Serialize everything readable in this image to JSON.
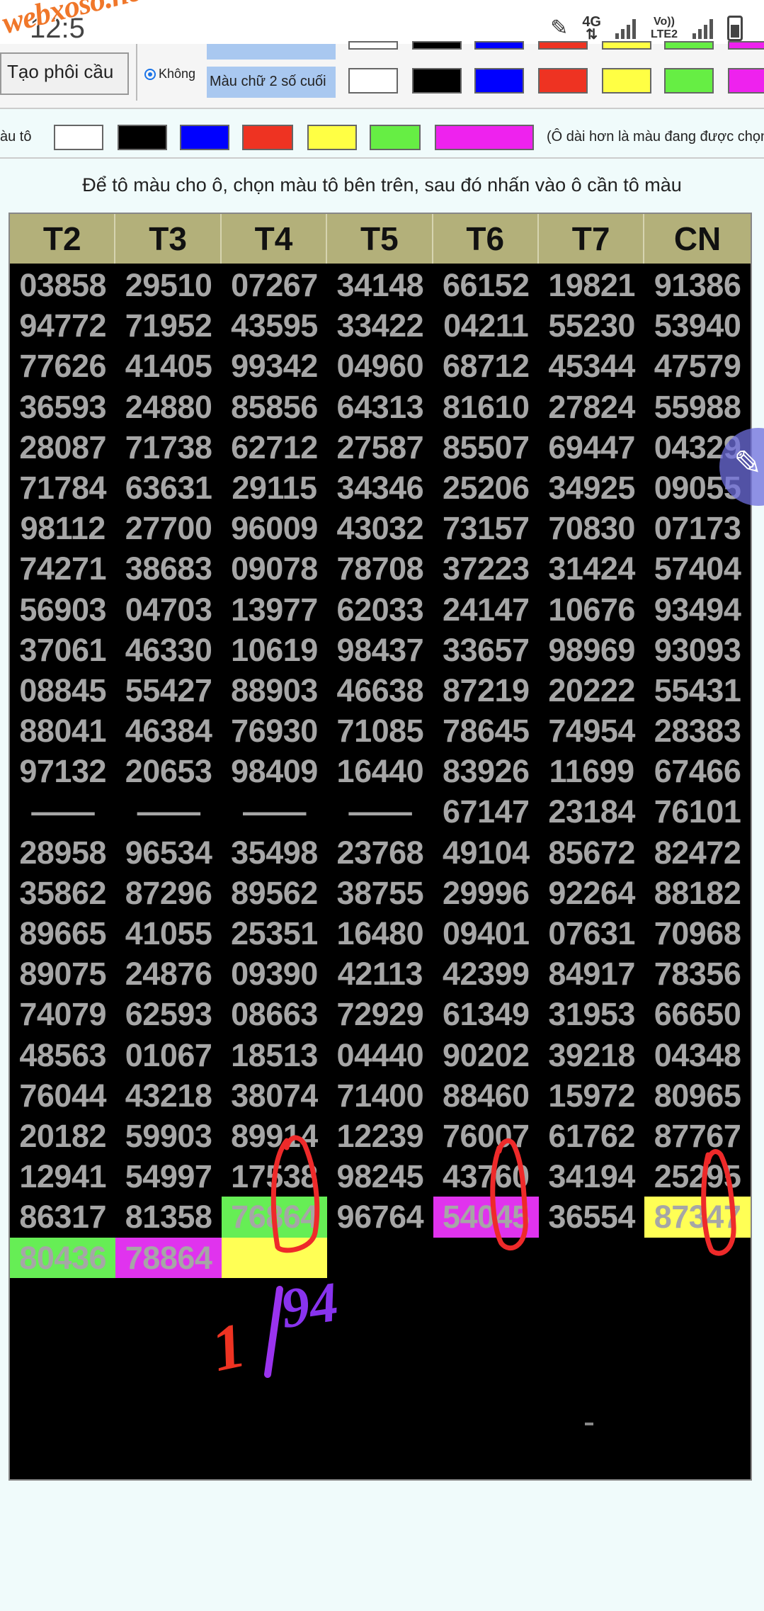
{
  "status_bar": {
    "time": "12:5",
    "logo_text": "webxoso.net",
    "network": "4G",
    "volte": "Vo)) LTE2"
  },
  "toolbar": {
    "create_button": "Tạo phôi cầu",
    "radio_label": "Không",
    "text_color_label": "Màu chữ 2 số cuối",
    "swatches": [
      "#ffffff",
      "#000000",
      "#0000ff",
      "#ee3322",
      "#ffff44",
      "#66ee44",
      "#ee22ee"
    ]
  },
  "fill_row": {
    "label": "àu tô",
    "swatches": [
      "#ffffff",
      "#000000",
      "#0000ff",
      "#ee3322",
      "#ffff44",
      "#66ee44",
      "#ee22ee"
    ],
    "note": "(Ô dài hơn là màu đang được chọn"
  },
  "instruction": "Để tô màu cho ô, chọn màu tô bên trên, sau đó nhấn vào ô cần tô màu",
  "table": {
    "headers": [
      "T2",
      "T3",
      "T4",
      "T5",
      "T6",
      "T7",
      "CN"
    ],
    "rows": [
      [
        "03858",
        "29510",
        "07267",
        "34148",
        "66152",
        "19821",
        "91386"
      ],
      [
        "94772",
        "71952",
        "43595",
        "33422",
        "04211",
        "55230",
        "53940"
      ],
      [
        "77626",
        "41405",
        "99342",
        "04960",
        "68712",
        "45344",
        "47579"
      ],
      [
        "36593",
        "24880",
        "85856",
        "64313",
        "81610",
        "27824",
        "55988"
      ],
      [
        "28087",
        "71738",
        "62712",
        "27587",
        "85507",
        "69447",
        "04329"
      ],
      [
        "71784",
        "63631",
        "29115",
        "34346",
        "25206",
        "34925",
        "09055"
      ],
      [
        "98112",
        "27700",
        "96009",
        "43032",
        "73157",
        "70830",
        "07173"
      ],
      [
        "74271",
        "38683",
        "09078",
        "78708",
        "37223",
        "31424",
        "57404"
      ],
      [
        "56903",
        "04703",
        "13977",
        "62033",
        "24147",
        "10676",
        "93494"
      ],
      [
        "37061",
        "46330",
        "10619",
        "98437",
        "33657",
        "98969",
        "93093"
      ],
      [
        "08845",
        "55427",
        "88903",
        "46638",
        "87219",
        "20222",
        "55431"
      ],
      [
        "88041",
        "46384",
        "76930",
        "71085",
        "78645",
        "74954",
        "28383"
      ],
      [
        "97132",
        "20653",
        "98409",
        "16440",
        "83926",
        "11699",
        "67466"
      ],
      [
        "——",
        "——",
        "——",
        "——",
        "67147",
        "23184",
        "76101"
      ],
      [
        "28958",
        "96534",
        "35498",
        "23768",
        "49104",
        "85672",
        "82472"
      ],
      [
        "35862",
        "87296",
        "89562",
        "38755",
        "29996",
        "92264",
        "88182"
      ],
      [
        "89665",
        "41055",
        "25351",
        "16480",
        "09401",
        "07631",
        "70968"
      ],
      [
        "89075",
        "24876",
        "09390",
        "42113",
        "42399",
        "84917",
        "78356"
      ],
      [
        "74079",
        "62593",
        "08663",
        "72929",
        "61349",
        "31953",
        "66650"
      ],
      [
        "48563",
        "01067",
        "18513",
        "04440",
        "90202",
        "39218",
        "04348"
      ],
      [
        "76044",
        "43218",
        "38074",
        "71400",
        "88460",
        "15972",
        "80965"
      ],
      [
        "20182",
        "59903",
        "89914",
        "12239",
        "76007",
        "61762",
        "87767"
      ],
      [
        "12941",
        "54997",
        "17538",
        "98245",
        "43760",
        "34194",
        "25295"
      ],
      [
        "86317",
        "81358",
        "76864",
        "96764",
        "54045",
        "36554",
        "87347"
      ],
      [
        "80436",
        "78864",
        "",
        "",
        "",
        "",
        ""
      ]
    ]
  },
  "handwriting": {
    "left_digit": "1",
    "right_digits": "94"
  }
}
